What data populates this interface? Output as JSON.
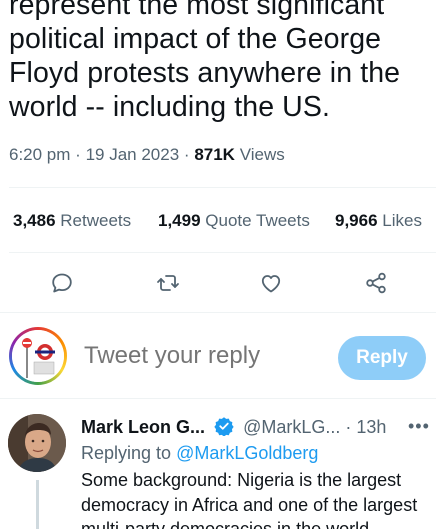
{
  "tweet": {
    "text_lines": [
      "represent the most significant",
      "political impact of the George",
      "Floyd protests anywhere in the",
      "world -- including the US."
    ],
    "time": "6:20 pm",
    "date": "19 Jan 2023",
    "views_count": "871K",
    "views_label": "Views",
    "separator": "·"
  },
  "stats": {
    "retweets_count": "3,486",
    "retweets_label": "Retweets",
    "quotes_count": "1,499",
    "quotes_label": "Quote Tweets",
    "likes_count": "9,966",
    "likes_label": "Likes"
  },
  "actions": [
    {
      "name": "reply-icon"
    },
    {
      "name": "retweet-icon"
    },
    {
      "name": "like-icon"
    },
    {
      "name": "share-icon"
    }
  ],
  "composer": {
    "placeholder": "Tweet your reply",
    "button_label": "Reply"
  },
  "reply": {
    "author_name": "Mark Leon G...",
    "handle": "@MarkLG...",
    "time": "· 13h",
    "more": "•••",
    "replying_prefix": "Replying to",
    "replying_to": "@MarkLGoldberg",
    "text_lines": [
      "Some background: Nigeria is the largest",
      "democracy in Africa and one of the largest",
      "multi-party democracies in the world."
    ]
  },
  "colors": {
    "accent": "#1d9bf0",
    "reply_button": "#8ecdf8",
    "muted_text": "#536471"
  }
}
